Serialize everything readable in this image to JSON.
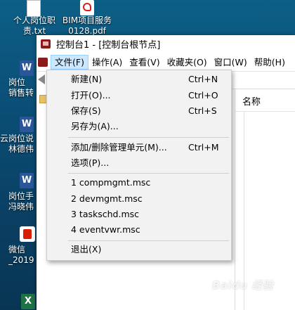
{
  "desktop": {
    "icons": [
      {
        "label": "个人岗位职\n责.txt"
      },
      {
        "label": "BIM项目服务\n0128.pdf"
      },
      {
        "label": "岗位\n销售转"
      },
      {
        "label": "云"
      },
      {
        "label": "岗位说\n林德伟"
      },
      {
        "label": "岗位手\n冯晓伟"
      },
      {
        "label": "微信\n_2019"
      }
    ]
  },
  "window": {
    "title": "控制台1 - [控制台根节点]",
    "menus": [
      "文件(F)",
      "操作(A)",
      "查看(V)",
      "收藏夹(O)",
      "窗口(W)",
      "帮助(H)"
    ],
    "list_header": "名称"
  },
  "file_menu": {
    "items": [
      {
        "label": "新建(N)",
        "shortcut": "Ctrl+N"
      },
      {
        "label": "打开(O)...",
        "shortcut": "Ctrl+O"
      },
      {
        "label": "保存(S)",
        "shortcut": "Ctrl+S"
      },
      {
        "label": "另存为(A)...",
        "shortcut": ""
      },
      {
        "label": "添加/删除管理单元(M)...",
        "shortcut": "Ctrl+M"
      },
      {
        "label": "选项(P)...",
        "shortcut": ""
      },
      {
        "label": "1 compmgmt.msc",
        "shortcut": ""
      },
      {
        "label": "2 devmgmt.msc",
        "shortcut": ""
      },
      {
        "label": "3 taskschd.msc",
        "shortcut": ""
      },
      {
        "label": "4 eventvwr.msc",
        "shortcut": ""
      },
      {
        "label": "退出(X)",
        "shortcut": ""
      }
    ]
  },
  "watermark": "Baidu 经验"
}
